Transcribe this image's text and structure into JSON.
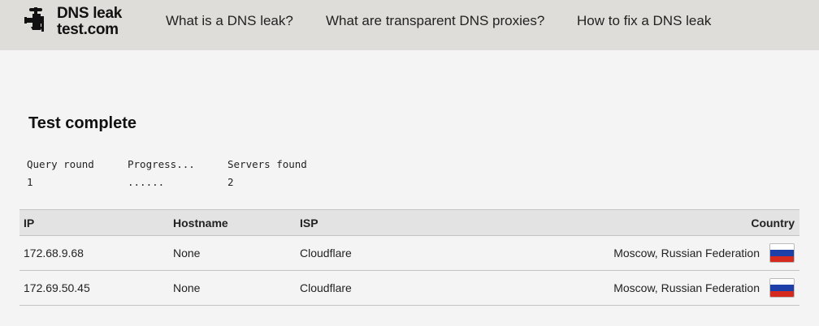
{
  "header": {
    "logo": {
      "line1": "DNS leak",
      "line2": "test.com"
    },
    "nav": [
      "What is a DNS leak?",
      "What are transparent DNS proxies?",
      "How to fix a DNS leak"
    ]
  },
  "status": {
    "title": "Test complete"
  },
  "stats": {
    "query_round": {
      "label": "Query round",
      "value": "1"
    },
    "progress": {
      "label": "Progress...",
      "value": "......"
    },
    "servers_found": {
      "label": "Servers found",
      "value": "2"
    }
  },
  "results": {
    "columns": [
      "IP",
      "Hostname",
      "ISP",
      "Country"
    ],
    "rows": [
      {
        "ip": "172.68.9.68",
        "hostname": "None",
        "isp": "Cloudflare",
        "location": "Moscow, Russian Federation",
        "flag": "russia-flag-icon"
      },
      {
        "ip": "172.69.50.45",
        "hostname": "None",
        "isp": "Cloudflare",
        "location": "Moscow, Russian Federation",
        "flag": "russia-flag-icon"
      }
    ]
  },
  "colors": {
    "header_bg": "#deddd9",
    "page_bg": "#f4f4f4",
    "table_header_bg": "#e3e3e3",
    "flag_white": "#ffffff",
    "flag_blue": "#1c3fa8",
    "flag_red": "#d52b1e"
  }
}
